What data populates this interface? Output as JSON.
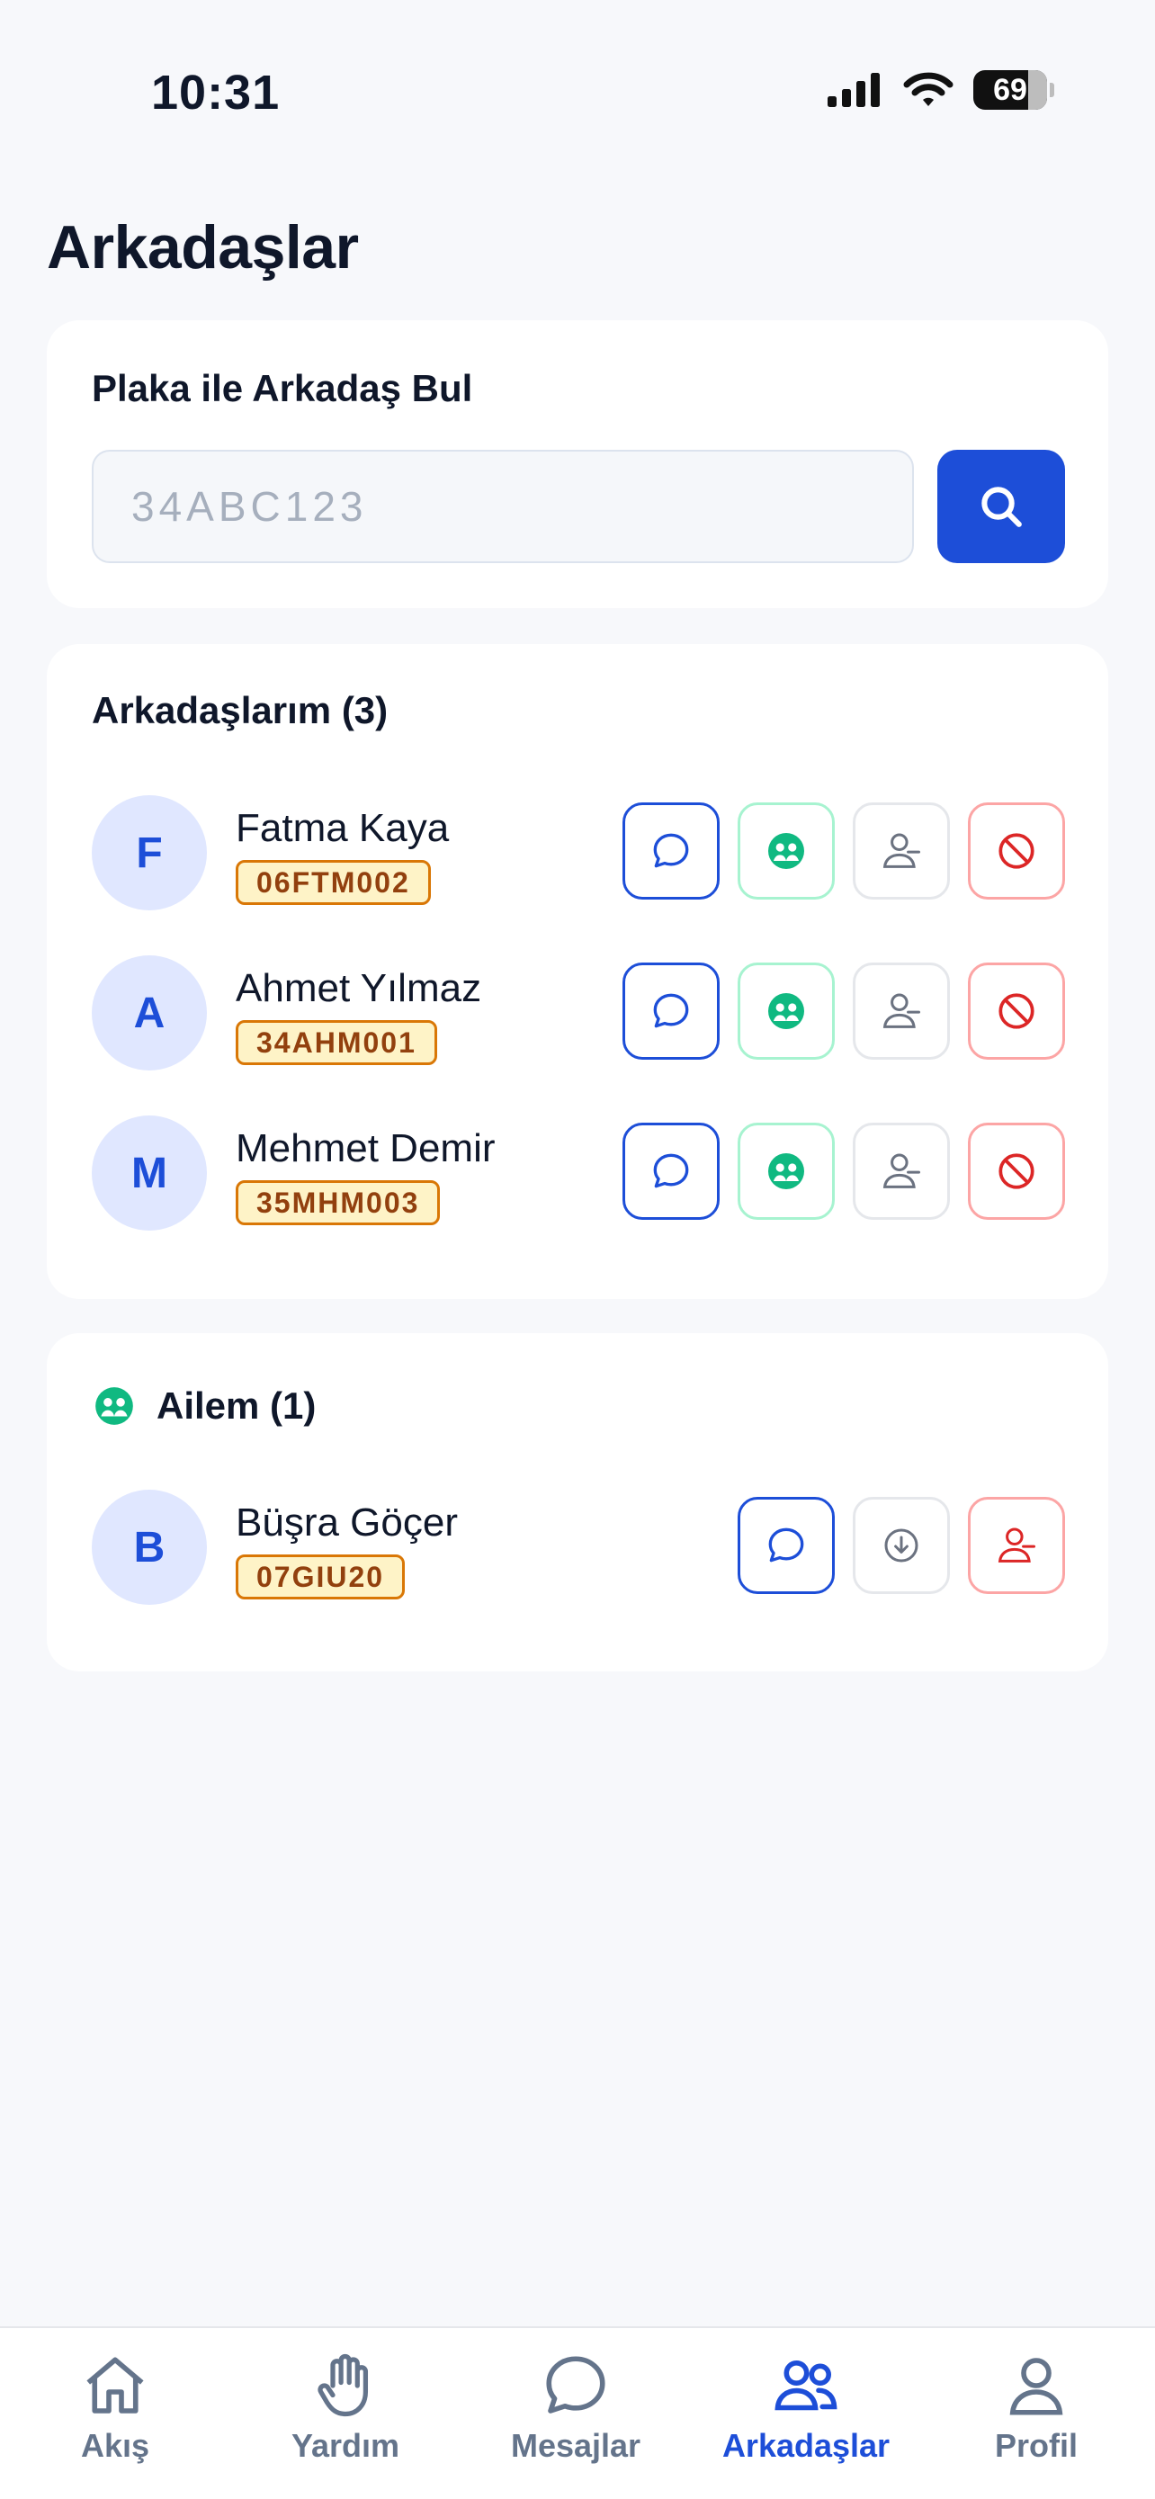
{
  "status_bar": {
    "time": "10:31",
    "battery": "69"
  },
  "page_title": "Arkadaşlar",
  "search": {
    "title": "Plaka ile Arkadaş Bul",
    "placeholder": "34ABC123"
  },
  "friends": {
    "title": "Arkadaşlarım (3)",
    "items": [
      {
        "initial": "F",
        "name": "Fatma Kaya",
        "plate": "06FTM002"
      },
      {
        "initial": "A",
        "name": "Ahmet Yılmaz",
        "plate": "34AHM001"
      },
      {
        "initial": "M",
        "name": "Mehmet Demir",
        "plate": "35MHM003"
      }
    ]
  },
  "family": {
    "title": "Ailem (1)",
    "items": [
      {
        "initial": "B",
        "name": "Büşra Göçer",
        "plate": "07GIU20"
      }
    ]
  },
  "tab_bar": {
    "tabs": [
      {
        "label": "Akış",
        "icon": "home-icon"
      },
      {
        "label": "Yardım",
        "icon": "hand-icon"
      },
      {
        "label": "Mesajlar",
        "icon": "chat-bubble-icon"
      },
      {
        "label": "Arkadaşlar",
        "icon": "users-icon",
        "active": true
      },
      {
        "label": "Profil",
        "icon": "user-icon"
      }
    ]
  },
  "colors": {
    "primary": "#1D4ED8",
    "plate_bg": "#FEF3C7",
    "plate_border": "#D97706",
    "family_green": "#10B981",
    "danger": "#DC2626"
  }
}
